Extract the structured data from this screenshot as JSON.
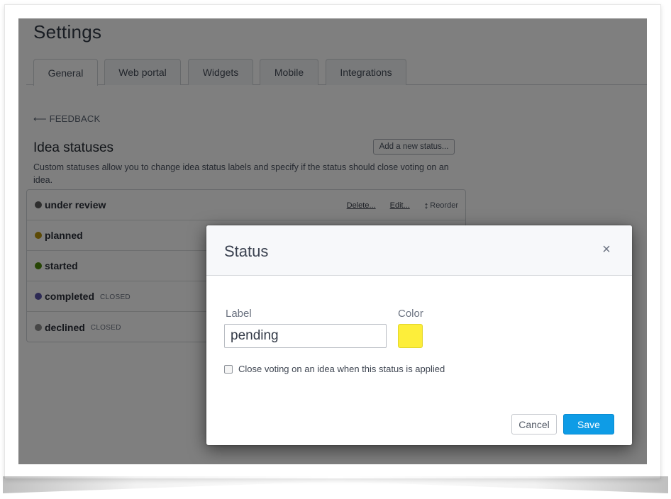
{
  "page": {
    "title": "Settings",
    "tabs": [
      {
        "label": "General",
        "active": true
      },
      {
        "label": "Web portal",
        "active": false
      },
      {
        "label": "Widgets",
        "active": false
      },
      {
        "label": "Mobile",
        "active": false
      },
      {
        "label": "Integrations",
        "active": false
      }
    ],
    "back_link": {
      "icon": "arrow-left-icon",
      "label": "FEEDBACK",
      "arrow": "⟵"
    },
    "section_title": "Idea statuses",
    "add_button": "Add a new status...",
    "description": "Custom statuses allow you to change idea status labels and specify if the status should close voting on an idea.",
    "row_actions": {
      "delete": "Delete...",
      "edit": "Edit...",
      "reorder": "Reorder",
      "reorder_icon": "↕"
    },
    "statuses": [
      {
        "name": "under review",
        "color": "#5c5c5c",
        "closed": "",
        "show_actions": true
      },
      {
        "name": "planned",
        "color": "#b8920a",
        "closed": ""
      },
      {
        "name": "started",
        "color": "#4f8a0b",
        "closed": ""
      },
      {
        "name": "completed",
        "color": "#5a55a8",
        "closed": "CLOSED"
      },
      {
        "name": "declined",
        "color": "#8c8c8c",
        "closed": "CLOSED"
      }
    ]
  },
  "modal": {
    "title": "Status",
    "close_icon": "×",
    "label_field": {
      "label": "Label",
      "value": "pending"
    },
    "color_field": {
      "label": "Color",
      "value": "#fdee3a"
    },
    "checkbox": {
      "label": "Close voting on an idea when this status is applied",
      "checked": false
    },
    "cancel_label": "Cancel",
    "save_label": "Save"
  }
}
